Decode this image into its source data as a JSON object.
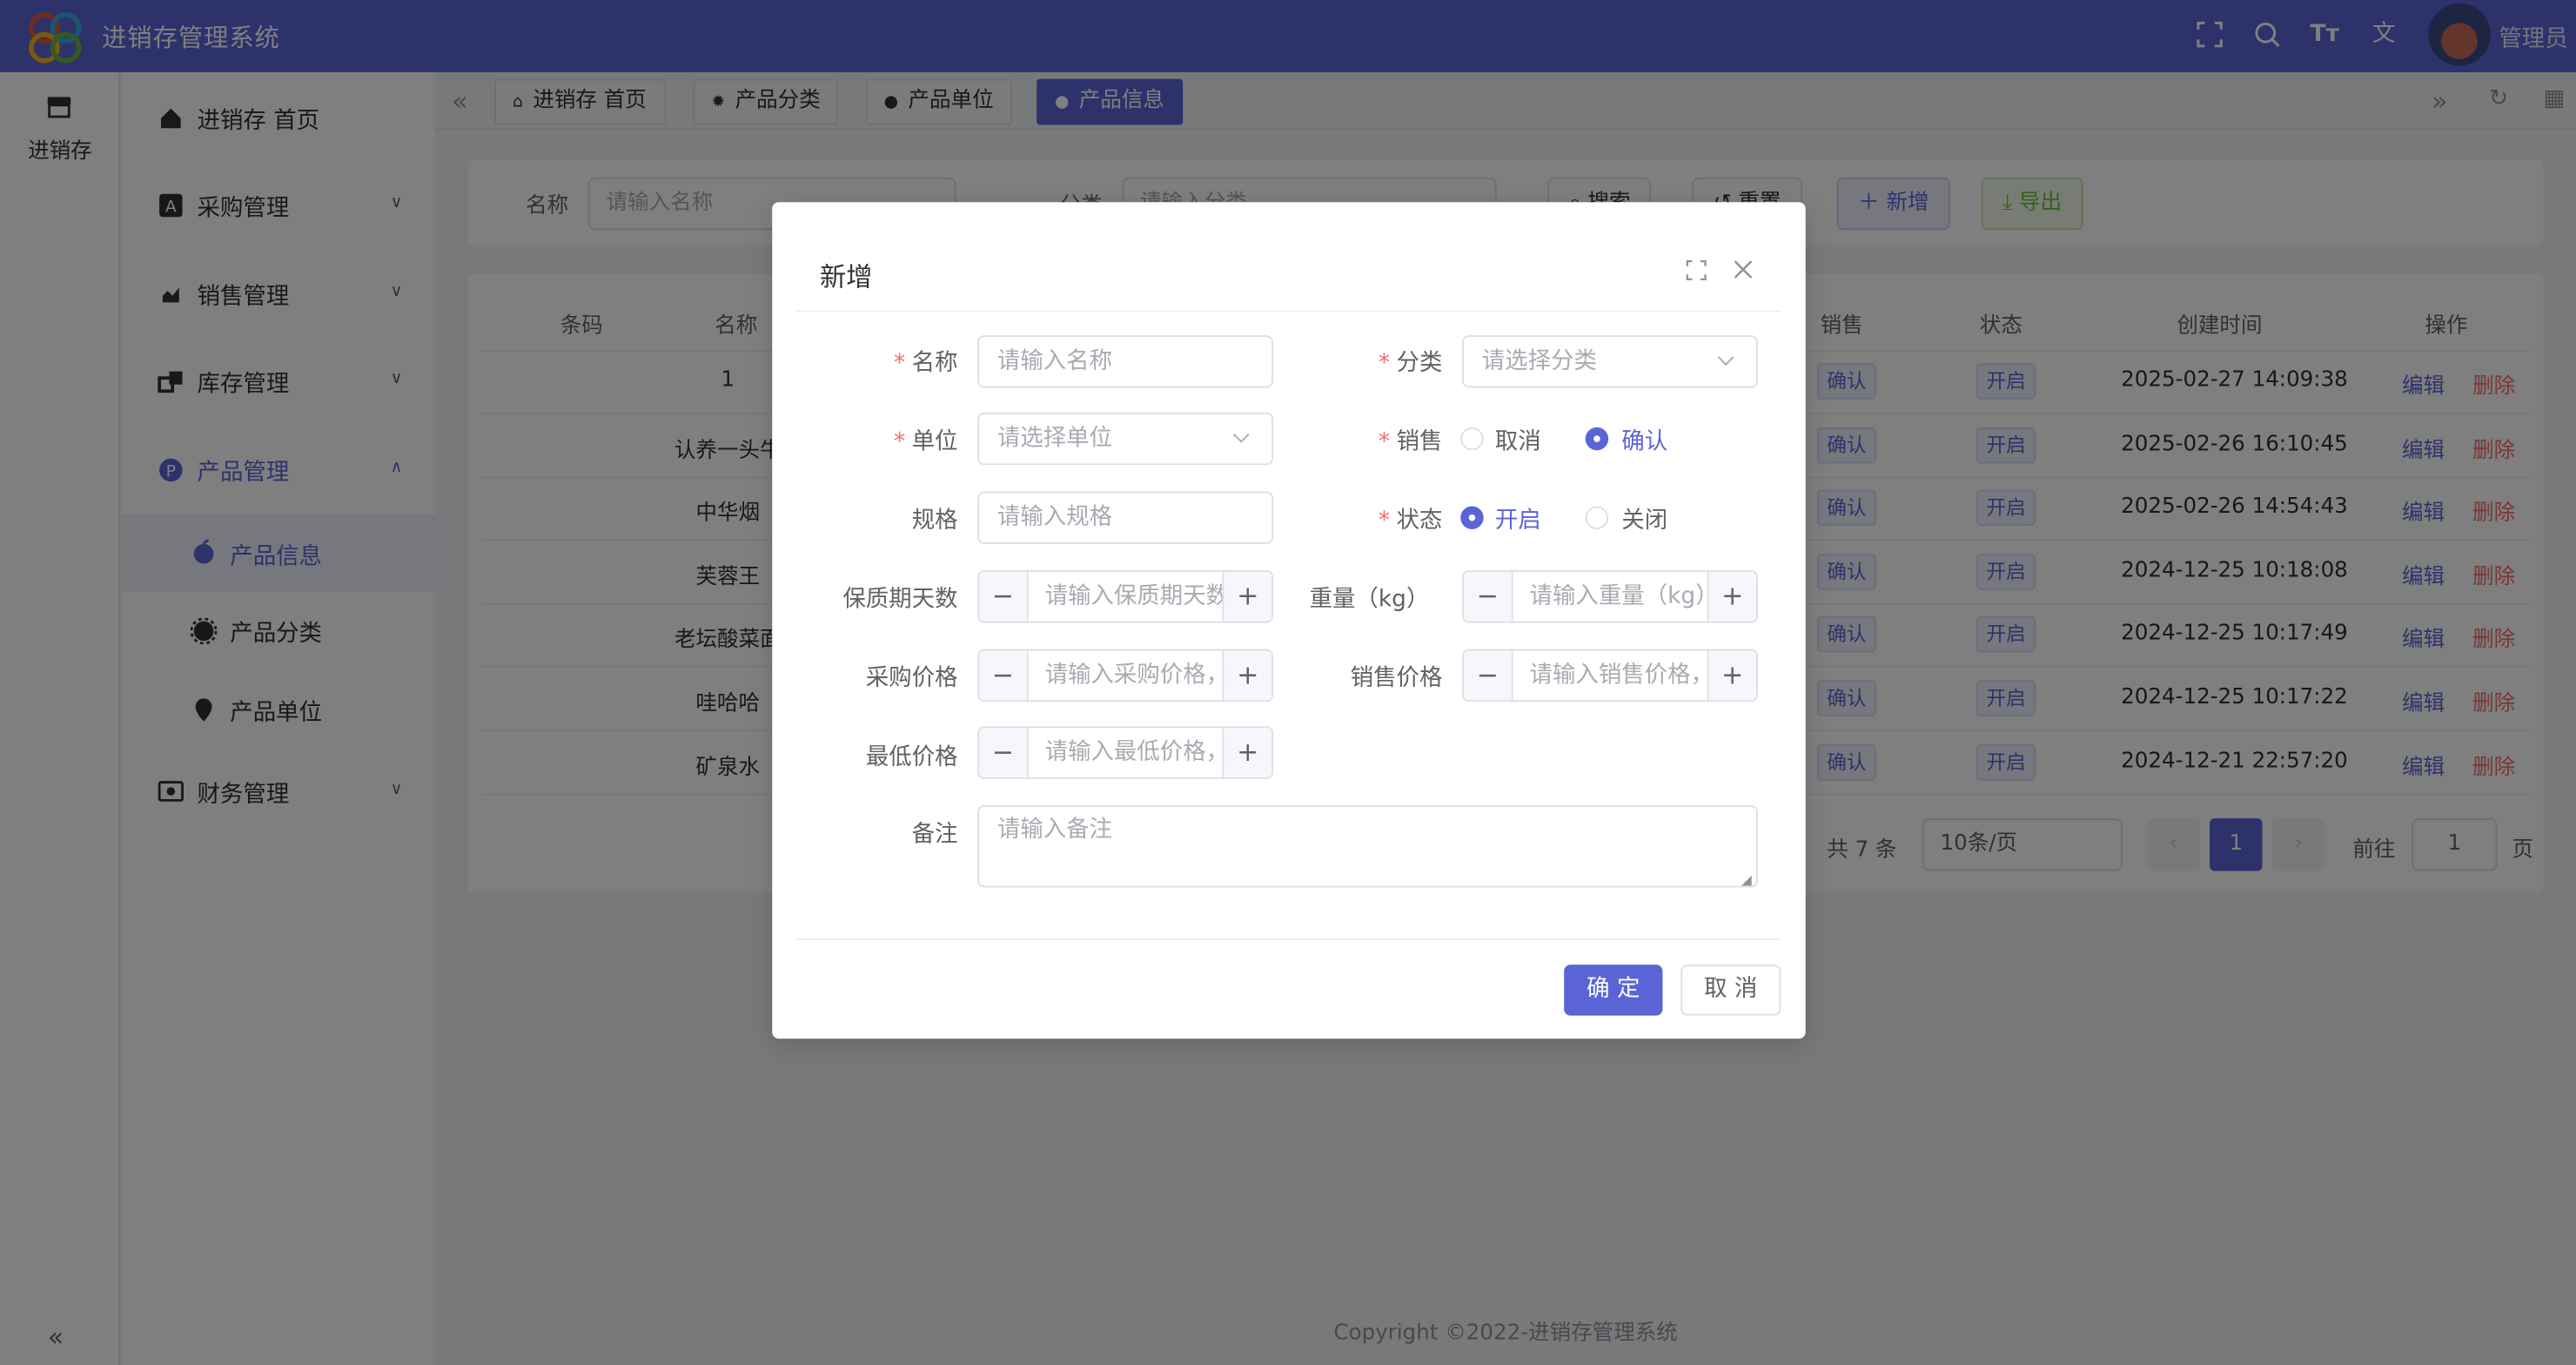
{
  "app": {
    "title": "进销存管理系统",
    "user": "管理员"
  },
  "rail": {
    "label": "进销存"
  },
  "menu": {
    "home": "进销存 首页",
    "purchase": "采购管理",
    "sales": "销售管理",
    "inventory": "库存管理",
    "product": "产品管理",
    "product_info": "产品信息",
    "product_category": "产品分类",
    "product_unit": "产品单位",
    "finance": "财务管理"
  },
  "tabs": [
    "进销存 首页",
    "产品分类",
    "产品单位",
    "产品信息"
  ],
  "search": {
    "name_label": "名称",
    "name_placeholder": "请输入名称",
    "category_label": "分类",
    "category_placeholder": "请输入分类",
    "search_btn": "搜索",
    "reset_btn": "重置",
    "add_btn": "新增",
    "export_btn": "导出"
  },
  "table": {
    "headers": {
      "code": "条码",
      "name": "名称",
      "sale": "销售",
      "status": "状态",
      "created": "创建时间",
      "ops": "操作"
    },
    "rows": [
      {
        "code": "",
        "name": "1",
        "sale": "确认",
        "status": "开启",
        "created": "2025-02-27 14:09:38"
      },
      {
        "code": "",
        "name": "认养一头牛",
        "sale": "确认",
        "status": "开启",
        "created": "2025-02-26 16:10:45"
      },
      {
        "code": "",
        "name": "中华烟",
        "sale": "确认",
        "status": "开启",
        "created": "2025-02-26 14:54:43"
      },
      {
        "code": "",
        "name": "芙蓉王",
        "sale": "确认",
        "status": "开启",
        "created": "2024-12-25 10:18:08"
      },
      {
        "code": "",
        "name": "老坛酸菜面",
        "sale": "确认",
        "status": "开启",
        "created": "2024-12-25 10:17:49"
      },
      {
        "code": "",
        "name": "哇哈哈",
        "sale": "确认",
        "status": "开启",
        "created": "2024-12-25 10:17:22"
      },
      {
        "code": "",
        "name": "矿泉水",
        "sale": "确认",
        "status": "开启",
        "created": "2024-12-21 22:57:20"
      }
    ],
    "edit": "编辑",
    "delete": "删除"
  },
  "pagination": {
    "total": "共 7 条",
    "page_size": "10条/页",
    "current": "1",
    "goto_label": "前往",
    "goto_value": "1",
    "page_suffix": "页"
  },
  "footer": {
    "copyright": "Copyright ©2022-进销存管理系统"
  },
  "dialog": {
    "title": "新增",
    "fields": {
      "name_label": "名称",
      "name_placeholder": "请输入名称",
      "category_label": "分类",
      "category_placeholder": "请选择分类",
      "unit_label": "单位",
      "unit_placeholder": "请选择单位",
      "sale_label": "销售",
      "sale_opt_cancel": "取消",
      "sale_opt_confirm": "确认",
      "spec_label": "规格",
      "spec_placeholder": "请输入规格",
      "status_label": "状态",
      "status_opt_on": "开启",
      "status_opt_off": "关闭",
      "shelf_label": "保质期天数",
      "shelf_placeholder": "请输入保质期天数",
      "weight_label": "重量（kg）",
      "weight_placeholder": "请输入重量（kg）",
      "purchase_label": "采购价格",
      "purchase_placeholder": "请输入采购价格，",
      "sellprice_label": "销售价格",
      "sellprice_placeholder": "请输入销售价格，",
      "minprice_label": "最低价格",
      "minprice_placeholder": "请输入最低价格，",
      "remark_label": "备注",
      "remark_placeholder": "请输入备注"
    },
    "confirm": "确 定",
    "cancel": "取 消"
  },
  "colors": {
    "primary": "#5a64d6",
    "danger": "#f56c6c",
    "header": "#5a64d6"
  }
}
